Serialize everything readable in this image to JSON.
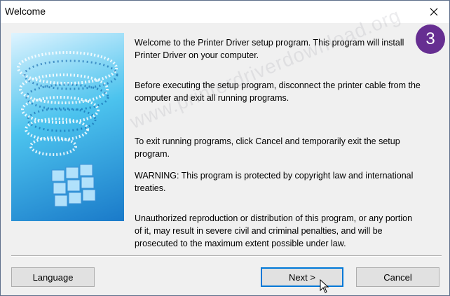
{
  "window": {
    "title": "Welcome"
  },
  "paragraphs": [
    "Welcome to the Printer Driver setup program. This program will install\nPrinter Driver on your computer.",
    "Before executing the setup program, disconnect the printer cable from the\ncomputer and exit all running programs.",
    "To exit running programs, click Cancel and temporarily exit the setup\nprogram.",
    "WARNING: This program is protected by copyright law and international\ntreaties.",
    "Unauthorized reproduction or distribution of this program, or any portion\nof it, may result in severe civil and criminal penalties, and will be\nprosecuted to the maximum extent possible under law."
  ],
  "badge": "3",
  "watermark": "www.printerdriverdownload.org",
  "buttons": {
    "language": "Language",
    "next": "Next >",
    "cancel": "Cancel"
  },
  "colors": {
    "badge": "#662e91",
    "default_button_border": "#0078d7"
  },
  "icons": [
    "close-icon",
    "mouse-pointer-icon"
  ]
}
